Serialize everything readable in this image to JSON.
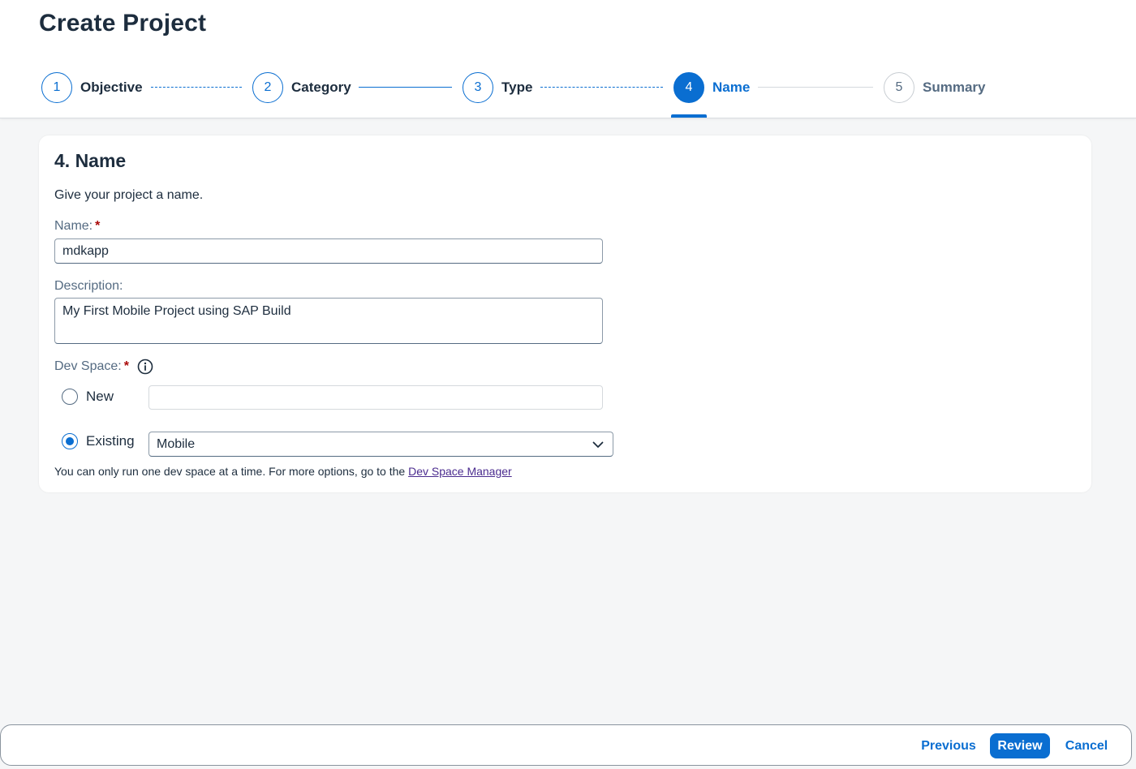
{
  "page": {
    "title": "Create Project"
  },
  "wizard": {
    "steps": [
      {
        "number": "1",
        "label": "Objective"
      },
      {
        "number": "2",
        "label": "Category"
      },
      {
        "number": "3",
        "label": "Type"
      },
      {
        "number": "4",
        "label": "Name"
      },
      {
        "number": "5",
        "label": "Summary"
      }
    ],
    "current_step": 4
  },
  "form": {
    "heading": "4. Name",
    "intro": "Give your project a name.",
    "name": {
      "label": "Name:",
      "required_marker": "*",
      "value": "mdkapp"
    },
    "description": {
      "label": "Description:",
      "value": "My First Mobile Project using SAP Build"
    },
    "dev_space": {
      "label": "Dev Space:",
      "required_marker": "*",
      "info_icon": "info-icon",
      "options": [
        {
          "label": "New",
          "selected": false,
          "value": ""
        },
        {
          "label": "Existing",
          "selected": true,
          "value": "Mobile"
        }
      ],
      "hint_text": "You can only run one dev space at a time. For more options, go to the ",
      "hint_link": "Dev Space Manager"
    }
  },
  "footer": {
    "previous_label": "Previous",
    "review_label": "Review",
    "cancel_label": "Cancel"
  },
  "colors": {
    "accent": "#0a6ed1",
    "required": "#aa0808",
    "link": "#4b2c8f"
  }
}
